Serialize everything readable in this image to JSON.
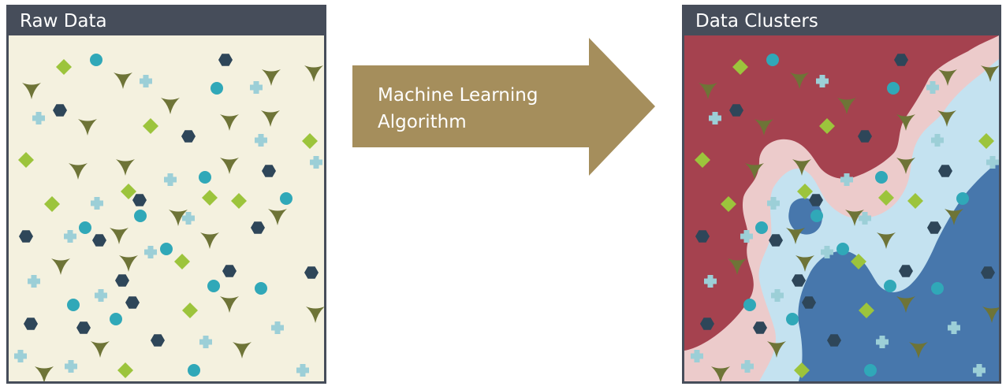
{
  "raw_panel": {
    "title": "Raw Data"
  },
  "arrow": {
    "label": "Machine Learning\nAlgorithm"
  },
  "clusters_panel": {
    "title": "Data Clusters"
  },
  "colors": {
    "header_bg": "#464d5a",
    "raw_background": "#f4f1df",
    "arrow_fill": "#a58e5c",
    "region_dark_red": "#a5424f",
    "region_light_pink": "#eccbcb",
    "region_light_blue": "#c4e2f0",
    "region_dark_blue": "#4777ac",
    "marker_diamond": "#9cc43c",
    "marker_circle": "#30a8b8",
    "marker_hexagon": "#2e4659",
    "marker_plus": "#9ccfd7",
    "marker_triangle": "#6e7437"
  },
  "marker_shapes": [
    "diamond",
    "circle",
    "hexagon",
    "plus",
    "triangle"
  ],
  "icons": {
    "arrow": "right-arrow-icon",
    "diamond": "diamond-icon",
    "circle": "circle-icon",
    "hexagon": "hexagon-icon",
    "plus": "plus-icon",
    "triangle": "triangle-icon"
  }
}
